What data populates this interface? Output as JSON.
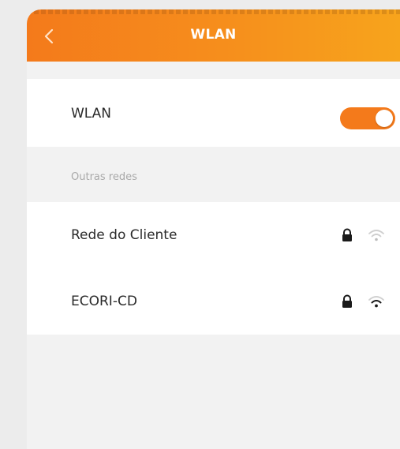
{
  "header": {
    "title": "WLAN",
    "back_icon": "chevron-left-icon",
    "gradient": [
      "#f47a1b",
      "#f7a41c"
    ]
  },
  "wlan_switch": {
    "label": "WLAN",
    "enabled": true,
    "accent": "#f47a1b"
  },
  "networks_section": {
    "heading": "Outras redes",
    "items": [
      {
        "ssid": "Rede do Cliente",
        "secured": true,
        "signal_icon": "wifi-weak-icon"
      },
      {
        "ssid": "ECORI-CD",
        "secured": true,
        "signal_icon": "wifi-icon"
      }
    ]
  }
}
